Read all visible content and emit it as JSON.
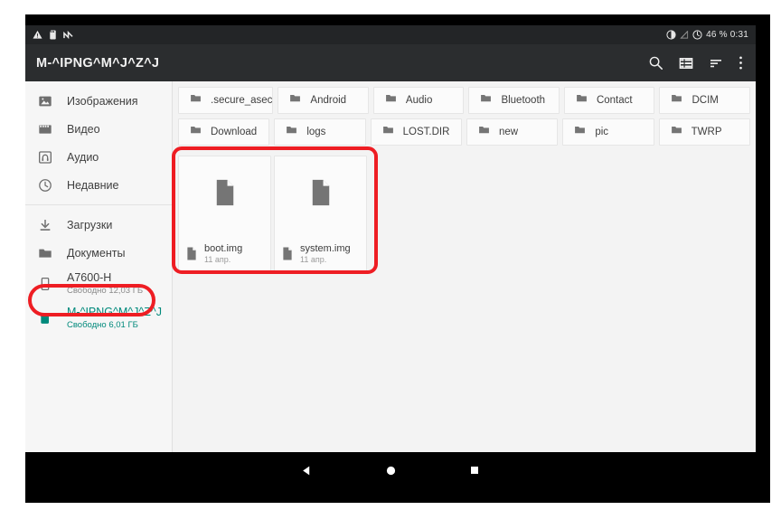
{
  "status_bar": {
    "left_icons": [
      "warning-triangle-icon",
      "sdcard-mount-icon",
      "usb-debug-icon"
    ],
    "battery_percent": "46 %",
    "clock": "0:31",
    "combined_right": "46 % 0:31"
  },
  "app_bar": {
    "title": "M-^IPNG^M^J^Z^J",
    "actions": [
      {
        "name": "search-icon",
        "label": "search"
      },
      {
        "name": "grid-view-icon",
        "label": "view mode"
      },
      {
        "name": "sort-icon",
        "label": "sort"
      },
      {
        "name": "overflow-menu-icon",
        "label": "more options"
      }
    ]
  },
  "sidebar": {
    "group_one": [
      {
        "label": "Изображения",
        "icon": "image-icon"
      },
      {
        "label": "Видео",
        "icon": "video-icon"
      },
      {
        "label": "Аудио",
        "icon": "audio-icon"
      },
      {
        "label": "Недавние",
        "icon": "clock-icon"
      }
    ],
    "group_two": [
      {
        "label": "Загрузки",
        "icon": "download-icon"
      },
      {
        "label": "Документы",
        "icon": "folder-icon"
      }
    ],
    "storages": [
      {
        "label": "A7600-H",
        "sub": "Свободно 12,03 ГБ",
        "icon": "phone-icon",
        "selected": false
      },
      {
        "label": "M-^IPNG^M^J^Z^J",
        "sub": "Свободно 6,01 ГБ",
        "icon": "sdcard-icon",
        "selected": true
      }
    ]
  },
  "content": {
    "folder_rows": [
      [
        ".secure_asec",
        "Android",
        "Audio",
        "Bluetooth",
        "Contact",
        "DCIM"
      ],
      [
        "Download",
        "logs",
        "LOST.DIR",
        "new",
        "pic",
        "TWRP"
      ]
    ],
    "files": [
      {
        "name": "boot.img",
        "date": "11 апр.",
        "icon": "file-icon"
      },
      {
        "name": "system.img",
        "date": "11 апр.",
        "icon": "file-icon"
      }
    ]
  },
  "nav_bar": {
    "buttons": [
      {
        "name": "back-button",
        "glyph": "triangle"
      },
      {
        "name": "home-button",
        "glyph": "circle"
      },
      {
        "name": "recents-button",
        "glyph": "square"
      }
    ]
  },
  "annotations": [
    {
      "name": "files-highlight",
      "color": "#ee1d23"
    },
    {
      "name": "sdcard-highlight",
      "color": "#ee1d23"
    }
  ],
  "colors": {
    "status_bar": "#232527",
    "app_bar": "#2b2d2f",
    "accent_teal": "#00897b",
    "annotation_red": "#ee1d23",
    "content_bg": "#f3f3f3"
  }
}
